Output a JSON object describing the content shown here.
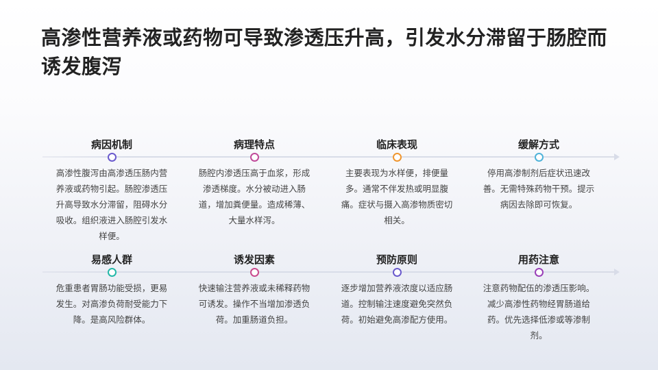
{
  "title": "高渗性营养液或药物可导致渗透压升高，引发水分滞留于肠腔而诱发腹泻",
  "items": [
    {
      "title": "病因机制",
      "color": "#6a5acd",
      "desc": "高渗性腹泻由高渗透压肠内营养液或药物引起。肠腔渗透压升高导致水分滞留，阻碍水分吸收。组织液进入肠腔引发水样便。"
    },
    {
      "title": "病理特点",
      "color": "#c04a9a",
      "desc": "肠腔内渗透压高于血浆，形成渗透梯度。水分被动进入肠道，增加粪便量。造成稀薄、大量水样泻。"
    },
    {
      "title": "临床表现",
      "color": "#f0962f",
      "desc": "主要表现为水样便，排便量多。通常不伴发热或明显腹痛。症状与摄入高渗物质密切相关。"
    },
    {
      "title": "缓解方式",
      "color": "#4fb3d9",
      "desc": "停用高渗制剂后症状迅速改善。无需特殊药物干预。提示病因去除即可恢复。"
    },
    {
      "title": "易感人群",
      "color": "#23b8a8",
      "desc": "危重患者胃肠功能受损，更易发生。对高渗负荷耐受能力下降。是高风险群体。"
    },
    {
      "title": "诱发因素",
      "color": "#c94a8e",
      "desc": "快速输注营养液或未稀释药物可诱发。操作不当增加渗透负荷。加重肠道负担。"
    },
    {
      "title": "预防原则",
      "color": "#6a5acd",
      "desc": "逐步增加营养液浓度以适应肠道。控制输注速度避免突然负荷。初始避免高渗配方使用。"
    },
    {
      "title": "用药注意",
      "color": "#9a3fb8",
      "desc": "注意药物配伍的渗透压影响。减少高渗性药物经胃肠道给药。优先选择低渗或等渗制剂。"
    }
  ]
}
